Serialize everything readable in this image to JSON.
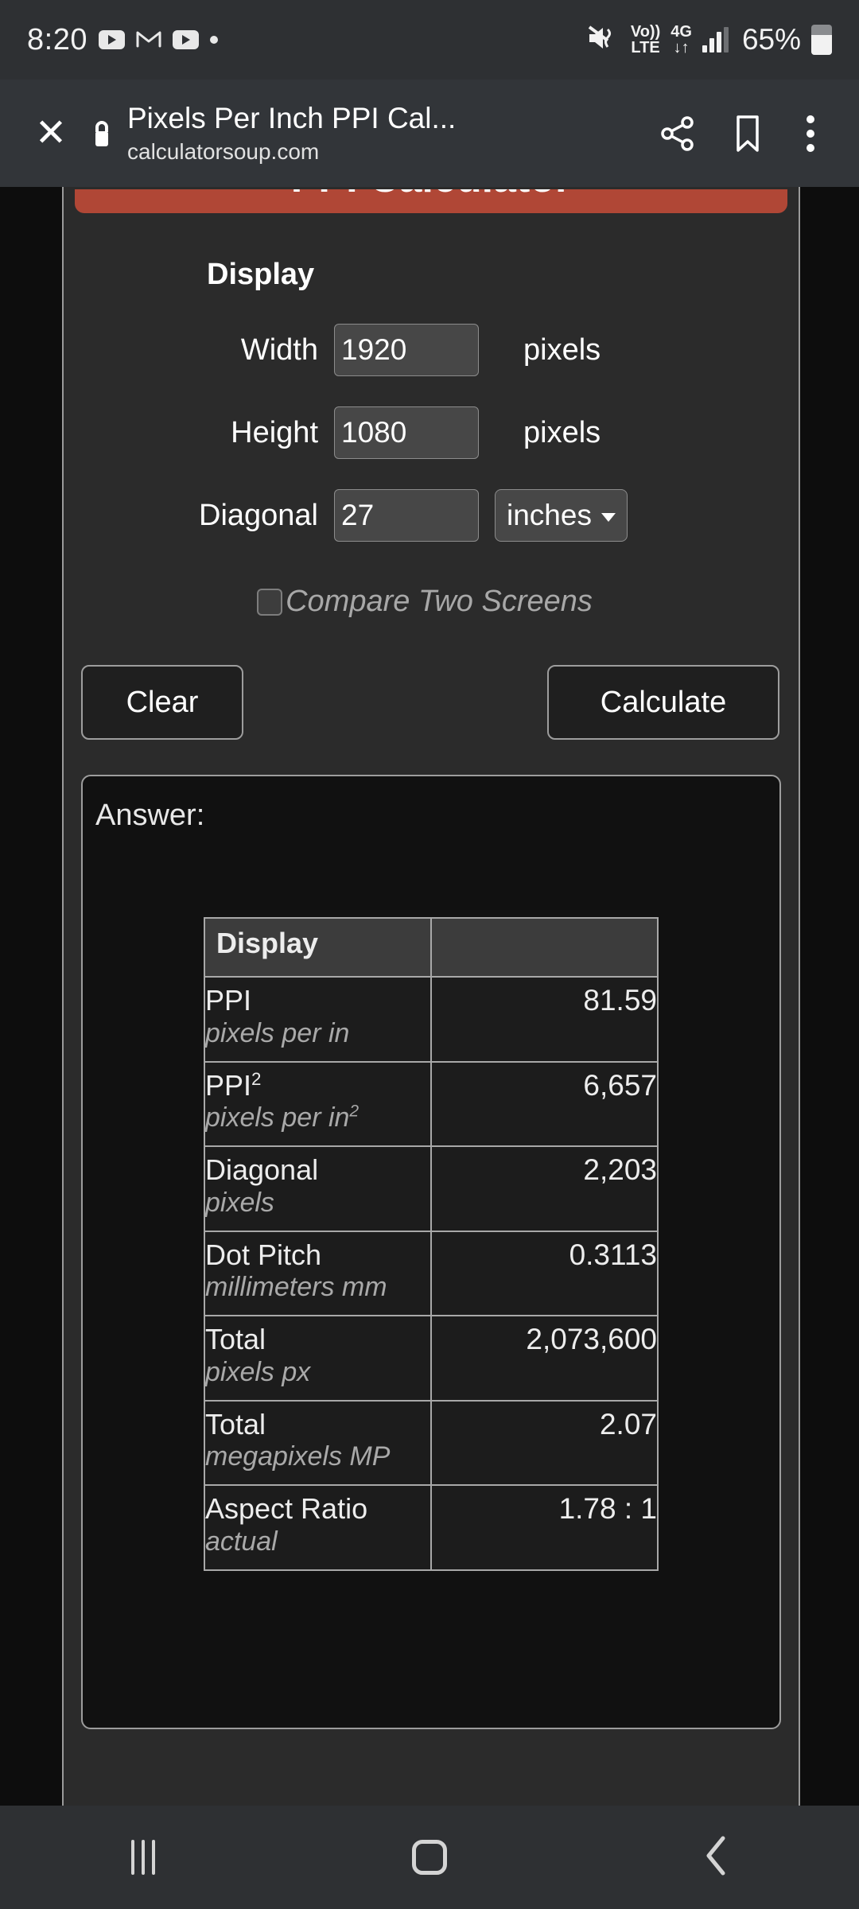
{
  "status_bar": {
    "time": "8:20",
    "icons": [
      "youtube-icon",
      "gmail-icon",
      "youtube-icon",
      "dot-icon"
    ],
    "mute_icon": "mute-vibrate-icon",
    "volte_line1": "Vo))",
    "volte_line2": "LTE",
    "network_line1": "4G",
    "network_line2": "↓↑",
    "signal_icon": "signal-bars-icon",
    "battery_percent": "65%",
    "battery_icon": "battery-icon"
  },
  "browser_header": {
    "close_icon": "close-icon",
    "lock_icon": "lock-icon",
    "title": "Pixels Per Inch PPI Cal...",
    "url": "calculatorsoup.com",
    "share_icon": "share-icon",
    "bookmark_icon": "bookmark-icon",
    "more_icon": "more-vertical-icon"
  },
  "page": {
    "banner": {
      "title": "PPI Calculator",
      "color": "#b04736"
    },
    "section_heading": "Display",
    "fields": [
      {
        "label": "Width",
        "value": "1920",
        "unit": "pixels"
      },
      {
        "label": "Height",
        "value": "1080",
        "unit": "pixels"
      },
      {
        "label": "Diagonal",
        "value": "27",
        "unit": ""
      }
    ],
    "unit_select": {
      "value": "inches",
      "caret_icon": "chevron-down-icon"
    },
    "compare_checkbox": {
      "label": "Compare Two Screens",
      "checked": false
    },
    "buttons": {
      "clear": "Clear",
      "calculate": "Calculate"
    },
    "answer": {
      "label": "Answer:",
      "table": {
        "headers": [
          "Display",
          ""
        ],
        "rows": [
          {
            "name": "PPI",
            "name_sup": "",
            "unit": "pixels per in",
            "unit_sup": "",
            "value": "81.59"
          },
          {
            "name": "PPI",
            "name_sup": "2",
            "unit": "pixels per in",
            "unit_sup": "2",
            "value": "6,657"
          },
          {
            "name": "Diagonal",
            "name_sup": "",
            "unit": "pixels",
            "unit_sup": "",
            "value": "2,203"
          },
          {
            "name": "Dot Pitch",
            "name_sup": "",
            "unit": "millimeters mm",
            "unit_sup": "",
            "value": "0.3113"
          },
          {
            "name": "Total",
            "name_sup": "",
            "unit": "pixels px",
            "unit_sup": "",
            "value": "2,073,600"
          },
          {
            "name": "Total",
            "name_sup": "",
            "unit": "megapixels MP",
            "unit_sup": "",
            "value": "2.07"
          },
          {
            "name": "Aspect Ratio",
            "name_sup": "",
            "unit": "actual",
            "unit_sup": "",
            "value": "1.78 : 1"
          }
        ]
      }
    }
  },
  "nav_bar": {
    "recents_icon": "recents-icon",
    "home_icon": "home-icon",
    "back_icon": "back-icon"
  }
}
